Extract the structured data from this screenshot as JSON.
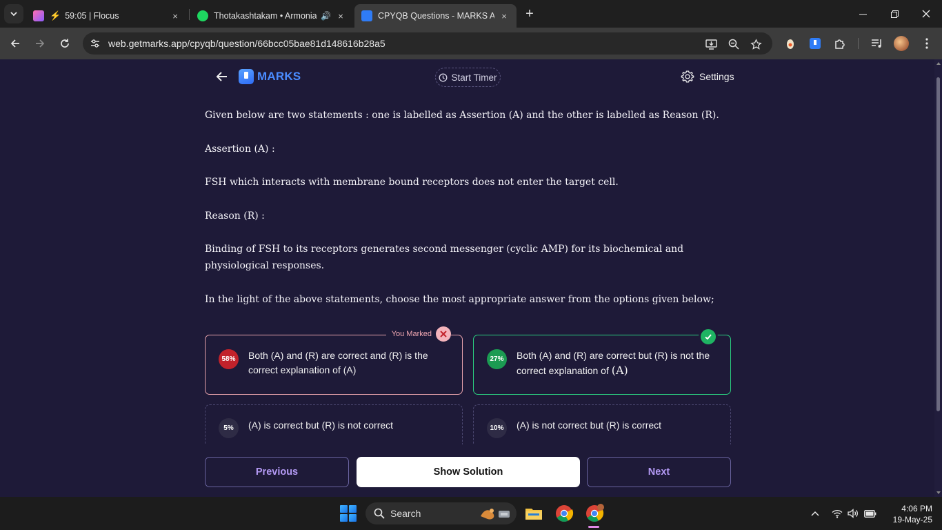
{
  "browser": {
    "tabs": [
      {
        "title": "59:05 | Flocus",
        "close": "×"
      },
      {
        "title": "Thotakashtakam • Armonian",
        "close": "×"
      },
      {
        "title": "CPYQB Questions - MARKS App",
        "close": "×"
      }
    ],
    "new_tab": "+",
    "url": "web.getmarks.app/cpyqb/question/66bcc05bae81d148616b28a5"
  },
  "app": {
    "logo_text": "MARKS",
    "timer_label": "Start Timer",
    "settings_label": "Settings"
  },
  "question": {
    "intro": "Given below are two statements : one is labelled as Assertion (A) and the other is labelled as Reason (R).",
    "assertion_label": "Assertion (A) :",
    "assertion_text": "FSH which interacts with membrane bound receptors does not enter the target cell.",
    "reason_label": "Reason (R) :",
    "reason_text": "Binding of FSH to its receptors generates second messenger (cyclic AMP) for its biochemical and physiological responses.",
    "instruction": "In the light of the above statements, choose the most appropriate answer from the options given below;"
  },
  "options": [
    {
      "percent": "58%",
      "text": "Both (A) and (R) are correct and (R) is the correct explanation of (A)",
      "tag": "You Marked",
      "color": "#c2222b"
    },
    {
      "percent": "27%",
      "text": "Both (A) and (R) are correct but (R) is not the correct explanation of",
      "text_math": "(A)",
      "color": "#1b9b52"
    },
    {
      "percent": "5%",
      "text": "(A) is correct but (R) is not correct",
      "color": "#2e2b45"
    },
    {
      "percent": "10%",
      "text": "(A) is not correct but (R) is correct",
      "color": "#2e2b45"
    }
  ],
  "nav": {
    "previous": "Previous",
    "show_solution": "Show Solution",
    "next": "Next"
  },
  "taskbar": {
    "search_label": "Search",
    "time": "4:06 PM",
    "date": "19-May-25"
  }
}
